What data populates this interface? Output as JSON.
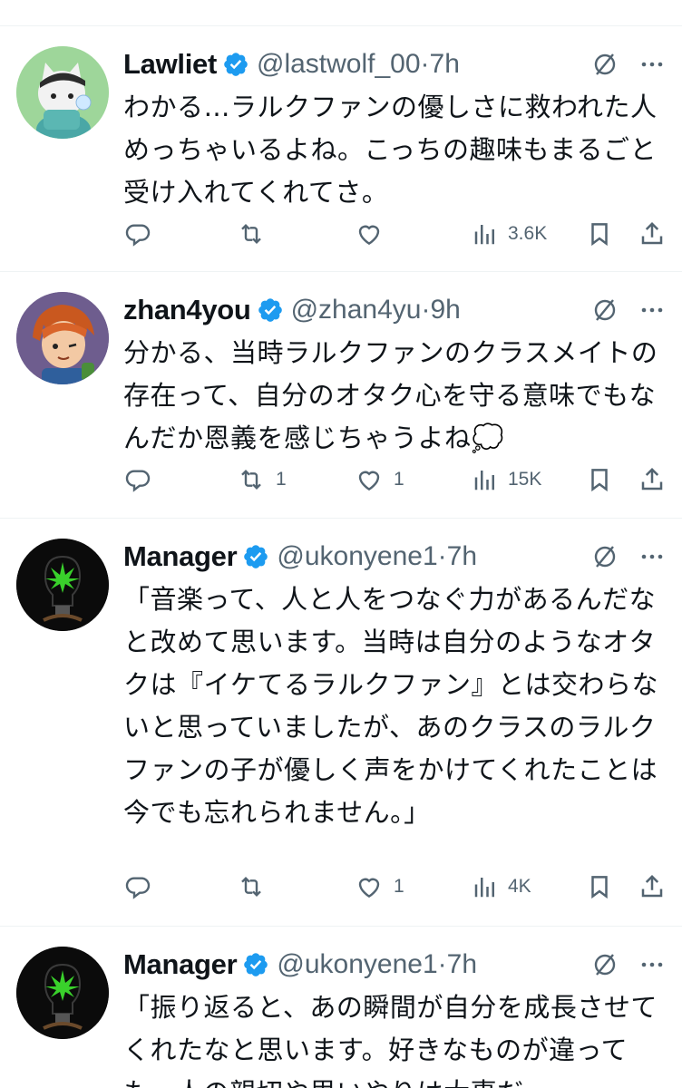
{
  "tweets": [
    {
      "name": "Lawliet",
      "handle": "@lastwolf_00",
      "time": "7h",
      "text": "わかる…ラルクファンの優しさに救われた人めっちゃいるよね。こっちの趣味もまるごと受け入れてくれてさ。",
      "replies": "",
      "reposts": "",
      "likes": "",
      "views": "3.6K",
      "avatar_icon": "cat-cartoon-avatar-icon"
    },
    {
      "name": "zhan4you",
      "handle": "@zhan4yu",
      "time": "9h",
      "text": "分かる、当時ラルクファンのクラスメイトの存在って、自分のオタク心を守る意味でもなんだか恩義を感じちゃうよね💭",
      "replies": "",
      "reposts": "1",
      "likes": "1",
      "views": "15K",
      "avatar_icon": "anime-boy-avatar-icon"
    },
    {
      "name": "Manager",
      "handle": "@ukonyene1",
      "time": "7h",
      "text": "「音楽って、人と人をつなぐ力があるんだなと改めて思います。当時は自分のようなオタクは『イケてるラルクファン』とは交わらないと思っていましたが、あのクラスのラルクファンの子が優しく声をかけてくれたことは今でも忘れられません。」",
      "replies": "",
      "reposts": "",
      "likes": "1",
      "views": "4K",
      "avatar_icon": "lightbulb-leaf-avatar-icon"
    },
    {
      "name": "Manager",
      "handle": "@ukonyene1",
      "time": "7h",
      "text": "「振り返ると、あの瞬間が自分を成長させてくれたなと思います。好きなものが違っても、人の親切や思いやりは大事だ",
      "avatar_icon": "lightbulb-leaf-avatar-icon"
    }
  ],
  "colors": {
    "text": "#0f1419",
    "secondary": "#536471",
    "verified": "#1d9bf0",
    "divider": "#eff3f4"
  }
}
